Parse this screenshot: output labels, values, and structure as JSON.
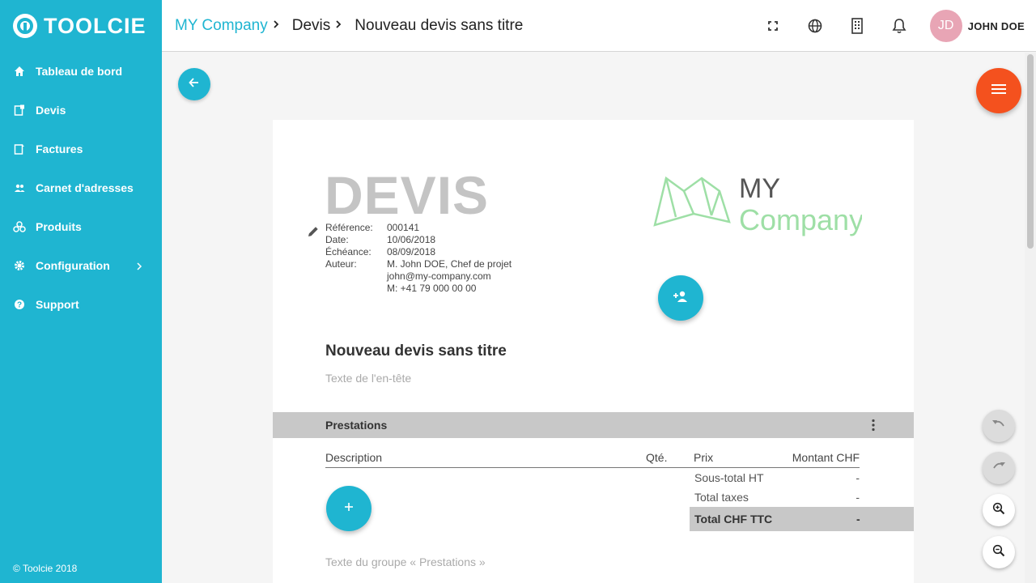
{
  "app": {
    "name": "TOOLCIE",
    "copyright": "© Toolcie 2018"
  },
  "sidebar": {
    "items": [
      {
        "label": "Tableau de bord",
        "icon": "home-icon"
      },
      {
        "label": "Devis",
        "icon": "quote-icon"
      },
      {
        "label": "Factures",
        "icon": "invoice-icon"
      },
      {
        "label": "Carnet d'adresses",
        "icon": "people-icon"
      },
      {
        "label": "Produits",
        "icon": "products-icon"
      },
      {
        "label": "Configuration",
        "icon": "gear-icon"
      },
      {
        "label": "Support",
        "icon": "help-icon"
      }
    ]
  },
  "header": {
    "breadcrumbs": [
      "MY Company",
      "Devis",
      "Nouveau devis sans titre"
    ],
    "user": {
      "initials": "JD",
      "name": "JOHN DOE"
    }
  },
  "document": {
    "title": "DEVIS",
    "meta": [
      {
        "label": "Référence:",
        "value": "000141"
      },
      {
        "label": "Date:",
        "value": "10/06/2018"
      },
      {
        "label": "Échéance:",
        "value": "08/09/2018"
      },
      {
        "label": "Auteur:",
        "value": "M. John DOE, Chef de projet"
      },
      {
        "label": "",
        "value": "john@my-company.com"
      },
      {
        "label": "",
        "value": "M: +41 79 000 00 00"
      }
    ],
    "company_logo": {
      "line1": "MY",
      "line2": "Company"
    },
    "name": "Nouveau devis sans titre",
    "header_text": "Texte de l'en-tête",
    "section": {
      "title": "Prestations",
      "columns": {
        "description": "Description",
        "qty": "Qté.",
        "price": "Prix",
        "amount": "Montant CHF"
      },
      "subtotal": {
        "label": "Sous-total HT",
        "value": "-"
      },
      "taxes": {
        "label": "Total taxes",
        "value": "-"
      },
      "total": {
        "label": "Total CHF TTC",
        "value": "-"
      },
      "group_text": "Texte du groupe « Prestations »"
    }
  },
  "colors": {
    "accent": "#1fb5d1",
    "fab": "#f4511e",
    "logo_green": "#9edfa6"
  }
}
